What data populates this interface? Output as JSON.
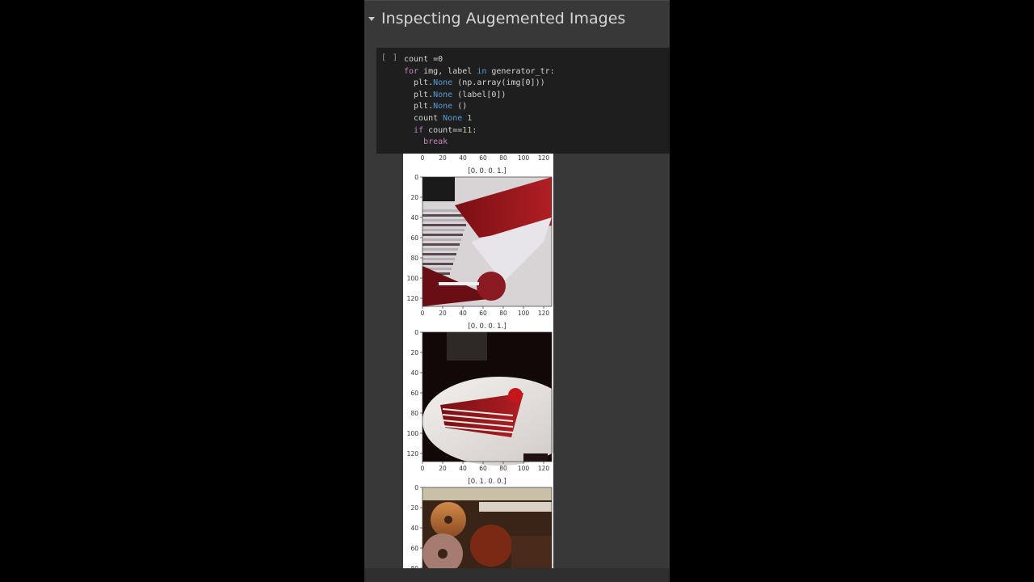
{
  "section": {
    "title": "Inspecting Augemented Images"
  },
  "cell": {
    "run_label": "[ ]",
    "lines": [
      [
        {
          "t": "count =0",
          "c": ""
        }
      ],
      [
        {
          "t": "for",
          "c": "ctl"
        },
        {
          "t": " img, label ",
          "c": ""
        },
        {
          "t": "in",
          "c": "kw"
        },
        {
          "t": " generator_tr:",
          "c": ""
        }
      ],
      [
        {
          "t": "  plt.",
          "c": ""
        },
        {
          "t": "None",
          "c": "kw"
        },
        {
          "t": " (np.array(img[0]))",
          "c": ""
        }
      ],
      [
        {
          "t": "  plt.",
          "c": ""
        },
        {
          "t": "None",
          "c": "kw"
        },
        {
          "t": " (label[0])",
          "c": ""
        }
      ],
      [
        {
          "t": "  plt.",
          "c": ""
        },
        {
          "t": "None",
          "c": "kw"
        },
        {
          "t": " ()",
          "c": ""
        }
      ],
      [
        {
          "t": "  count ",
          "c": ""
        },
        {
          "t": "None",
          "c": "kw"
        },
        {
          "t": " ",
          "c": ""
        },
        {
          "t": "1",
          "c": "num"
        }
      ],
      [
        {
          "t": "  ",
          "c": ""
        },
        {
          "t": "if",
          "c": "ctl"
        },
        {
          "t": " count==",
          "c": ""
        },
        {
          "t": "11",
          "c": "num"
        },
        {
          "t": ":",
          "c": ""
        }
      ],
      [
        {
          "t": "    ",
          "c": ""
        },
        {
          "t": "break",
          "c": "ctl"
        }
      ]
    ]
  },
  "output": {
    "x_ticks": [
      "0",
      "20",
      "40",
      "60",
      "80",
      "100",
      "120"
    ],
    "y_ticks": [
      "0",
      "20",
      "40",
      "60",
      "80",
      "100",
      "120"
    ],
    "plots": [
      {
        "title": "[0. 0. 0. 1.]",
        "subject": "augmented red velvet cake photo"
      },
      {
        "title": "[0. 0. 0. 1.]",
        "subject": "red velvet cake slice on plate"
      },
      {
        "title": "[0. 1. 0. 0.]",
        "subject": "donuts photo"
      }
    ]
  },
  "colors": {
    "panel": "#383838",
    "code_bg": "#1e1e1e",
    "keyword": "#569cd6",
    "control": "#c586c0",
    "number": "#b5cea8"
  }
}
